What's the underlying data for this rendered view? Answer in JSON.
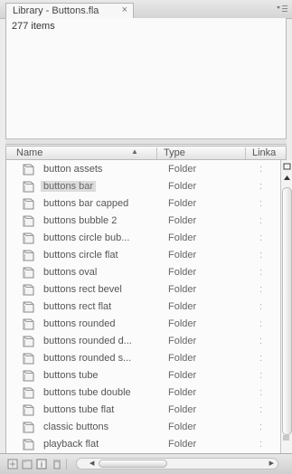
{
  "panel": {
    "tab_title": "Library - Buttons.fla",
    "tab_close": "×",
    "options_icon": "panel-menu-icon",
    "item_count": "277 items"
  },
  "columns": {
    "name": "Name",
    "sort_indicator": "▲",
    "type": "Type",
    "linkage": "Linka"
  },
  "items": [
    {
      "name": "button assets",
      "type": "Folder"
    },
    {
      "name": "buttons bar",
      "type": "Folder",
      "selected": true
    },
    {
      "name": "buttons bar capped",
      "type": "Folder"
    },
    {
      "name": "buttons bubble 2",
      "type": "Folder"
    },
    {
      "name": "buttons circle bub...",
      "type": "Folder"
    },
    {
      "name": "buttons circle flat",
      "type": "Folder"
    },
    {
      "name": "buttons oval",
      "type": "Folder"
    },
    {
      "name": "buttons rect bevel",
      "type": "Folder"
    },
    {
      "name": "buttons rect flat",
      "type": "Folder"
    },
    {
      "name": "buttons rounded",
      "type": "Folder"
    },
    {
      "name": "buttons rounded d...",
      "type": "Folder"
    },
    {
      "name": "buttons rounded s...",
      "type": "Folder"
    },
    {
      "name": "buttons tube",
      "type": "Folder"
    },
    {
      "name": "buttons tube double",
      "type": "Folder"
    },
    {
      "name": "buttons tube flat",
      "type": "Folder"
    },
    {
      "name": "classic buttons",
      "type": "Folder"
    },
    {
      "name": "playback flat",
      "type": "Folder"
    }
  ],
  "row_linkage_placeholder": ":",
  "bottom_toolbar": [
    "new-symbol-icon",
    "new-folder-icon",
    "properties-icon",
    "delete-icon"
  ],
  "colors": {
    "panel_bg": "#ececec",
    "list_bg": "#fbfbfb",
    "selection": "#dcdcdc",
    "folder_icon": "#888888"
  }
}
